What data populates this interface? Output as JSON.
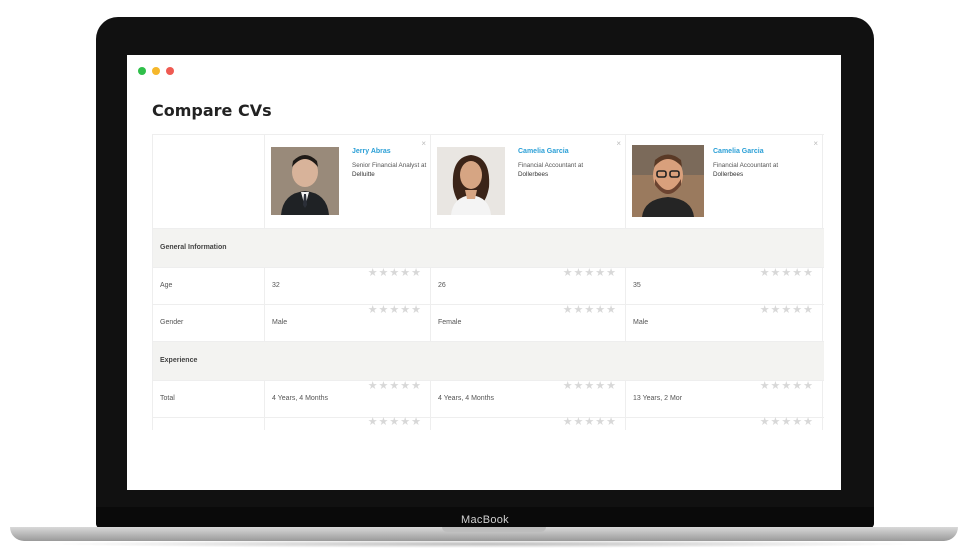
{
  "device": {
    "brand_label": "MacBook"
  },
  "window": {
    "controls": [
      {
        "name": "maximize",
        "color": "#2fbf4a"
      },
      {
        "name": "minimize",
        "color": "#f5b72b"
      },
      {
        "name": "close",
        "color": "#ef5a52"
      }
    ]
  },
  "page": {
    "title": "Compare CVs"
  },
  "candidates": [
    {
      "name": "Jerry Abras",
      "role": "Senior Financial Analyst",
      "at": "at",
      "company": "Delluitte",
      "close": "×"
    },
    {
      "name": "Camelia Garcia",
      "role": "Financial Accountant",
      "at": "at",
      "company": "Dollerbees",
      "close": "×"
    },
    {
      "name": "Camelia Garcia",
      "role": "Financial Accountant",
      "at": "at",
      "company": "Dollerbees",
      "close": "×"
    }
  ],
  "sections": {
    "general": "General Information",
    "experience": "Experience"
  },
  "rows": {
    "age": {
      "label": "Age",
      "values": [
        "32",
        "26",
        "35"
      ]
    },
    "gender": {
      "label": "Gender",
      "values": [
        "Male",
        "Female",
        "Male"
      ]
    },
    "total": {
      "label": "Total",
      "values": [
        "4 Years, 4 Months",
        "4 Years, 4 Months",
        "13 Years, 2 Mor"
      ]
    }
  },
  "rating": {
    "stars": "★★★★★",
    "filled": 0,
    "max": 5
  },
  "colors": {
    "link": "#2a9fd6",
    "section_bg": "#f3f3f1",
    "star_empty": "#d8d8d8"
  }
}
